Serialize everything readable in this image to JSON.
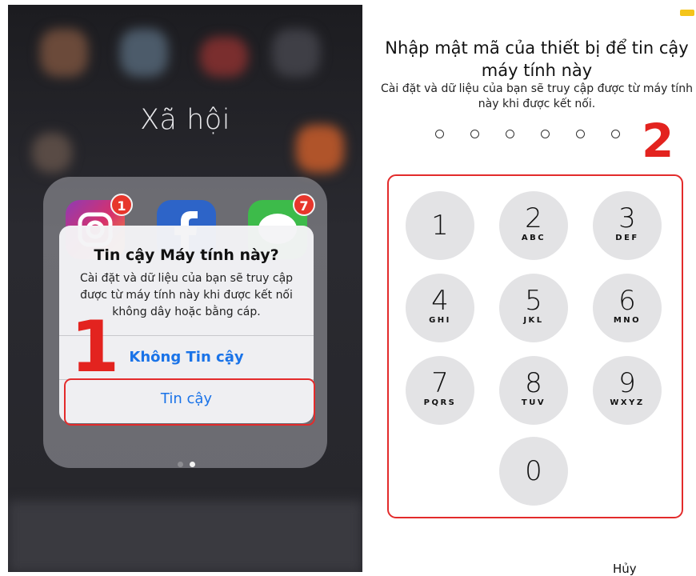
{
  "left": {
    "folder_title": "Xã hội",
    "badges": [
      "1",
      "7"
    ],
    "alert": {
      "title": "Tin cậy Máy tính này?",
      "message": "Cài đặt và dữ liệu của bạn sẽ truy cập được từ máy tính này khi được kết nối không dây hoặc bằng cáp.",
      "dont_trust_label": "Không Tin cậy",
      "trust_label": "Tin cậy"
    },
    "step_label": "1",
    "icons": [
      "instagram-icon",
      "facebook-icon",
      "line-icon"
    ]
  },
  "right": {
    "title": "Nhập mật mã của thiết bị để tin cậy máy tính này",
    "subtitle": "Cài đặt và dữ liệu của bạn sẽ truy cập được từ máy tính này khi được kết nối.",
    "pin_length": 6,
    "step_label": "2",
    "keypad": [
      {
        "num": "1",
        "letters": ""
      },
      {
        "num": "2",
        "letters": "ABC"
      },
      {
        "num": "3",
        "letters": "DEF"
      },
      {
        "num": "4",
        "letters": "GHI"
      },
      {
        "num": "5",
        "letters": "JKL"
      },
      {
        "num": "6",
        "letters": "MNO"
      },
      {
        "num": "7",
        "letters": "PQRS"
      },
      {
        "num": "8",
        "letters": "TUV"
      },
      {
        "num": "9",
        "letters": "WXYZ"
      },
      {
        "num": "0",
        "letters": ""
      }
    ],
    "cancel_label": "Hủy"
  },
  "colors": {
    "accent_blue": "#1a73e8",
    "highlight_red": "#e3231f",
    "badge_red": "#e7362c",
    "key_gray": "#e3e3e5"
  }
}
